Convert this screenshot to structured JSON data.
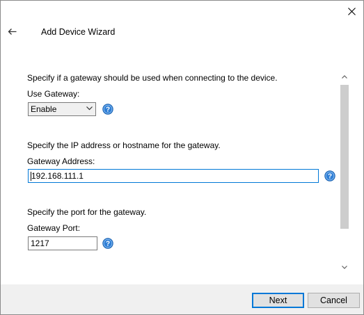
{
  "window": {
    "title": "Add Device Wizard"
  },
  "gateway_usage": {
    "description": "Specify if a gateway should be used when connecting to the device.",
    "label": "Use Gateway:",
    "selected": "Enable"
  },
  "gateway_address": {
    "description": "Specify the IP address or hostname for the gateway.",
    "label": "Gateway Address:",
    "value": "192.168.111.1"
  },
  "gateway_port": {
    "description": "Specify the port for the gateway.",
    "label": "Gateway Port:",
    "value": "1217"
  },
  "footer": {
    "next_label": "Next",
    "cancel_label": "Cancel"
  },
  "icons": {
    "help": "help-icon",
    "back": "back-arrow-icon",
    "close": "close-icon"
  },
  "colors": {
    "accent": "#0078d7",
    "help_blue": "#2f7fd6"
  }
}
